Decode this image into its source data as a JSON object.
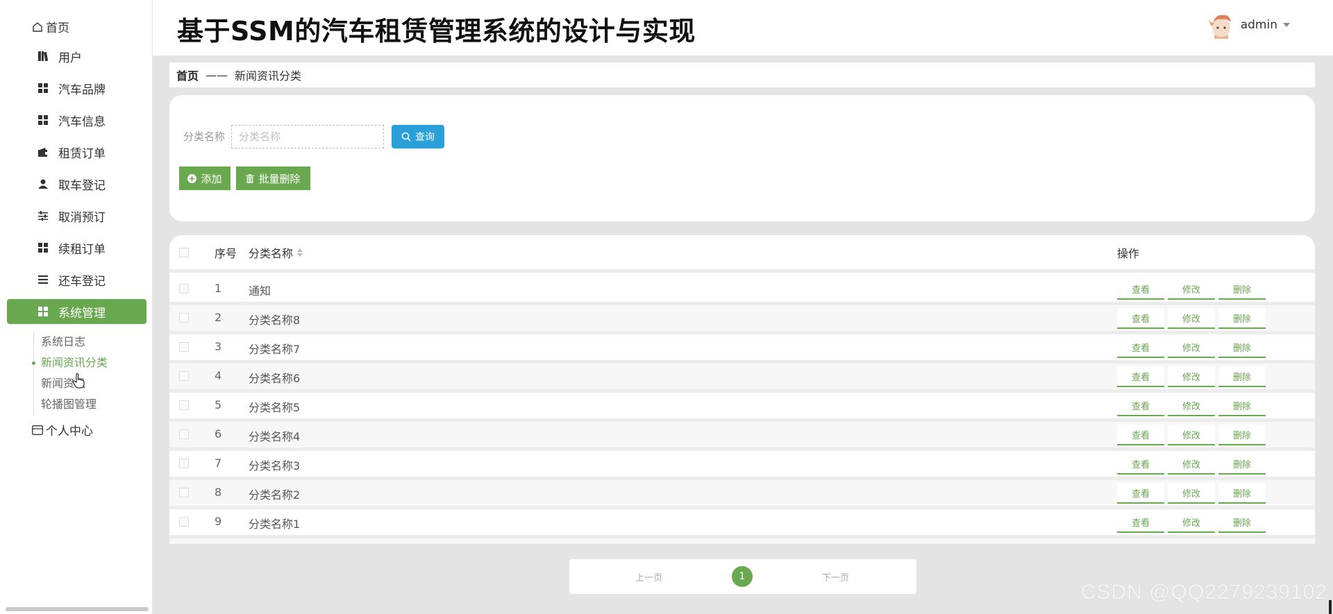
{
  "header": {
    "title": "基于SSM的汽车租赁管理系统的设计与实现",
    "username": "admin"
  },
  "sidebar": {
    "home": "首页",
    "items": [
      {
        "label": "用户",
        "icon": "book-icon"
      },
      {
        "label": "汽车品牌",
        "icon": "grid-icon"
      },
      {
        "label": "汽车信息",
        "icon": "grid-icon"
      },
      {
        "label": "租赁订单",
        "icon": "wallet-icon"
      },
      {
        "label": "取车登记",
        "icon": "user-icon"
      },
      {
        "label": "取消预订",
        "icon": "sliders-icon"
      },
      {
        "label": "续租订单",
        "icon": "grid-icon"
      },
      {
        "label": "还车登记",
        "icon": "list-icon"
      },
      {
        "label": "系统管理",
        "icon": "grid-icon",
        "active": true
      }
    ],
    "submenu": [
      {
        "label": "系统日志"
      },
      {
        "label": "新闻资讯分类",
        "active": true
      },
      {
        "label": "新闻资讯"
      },
      {
        "label": "轮播图管理"
      }
    ],
    "personal": "个人中心"
  },
  "breadcrumb": {
    "home": "首页",
    "separator": "——",
    "current": "新闻资讯分类"
  },
  "search": {
    "label": "分类名称",
    "placeholder": "分类名称",
    "value": "",
    "query_button": "查询",
    "add_button": "添加",
    "batch_delete_button": "批量删除"
  },
  "table": {
    "headers": {
      "no": "序号",
      "name": "分类名称",
      "actions": "操作"
    },
    "rows": [
      {
        "no": "1",
        "name": "通知"
      },
      {
        "no": "2",
        "name": "分类名称8"
      },
      {
        "no": "3",
        "name": "分类名称7"
      },
      {
        "no": "4",
        "name": "分类名称6"
      },
      {
        "no": "5",
        "name": "分类名称5"
      },
      {
        "no": "6",
        "name": "分类名称4"
      },
      {
        "no": "7",
        "name": "分类名称3"
      },
      {
        "no": "8",
        "name": "分类名称2"
      },
      {
        "no": "9",
        "name": "分类名称1"
      }
    ],
    "actions": {
      "view": "查看",
      "edit": "修改",
      "delete": "删除"
    }
  },
  "pagination": {
    "prev": "上一页",
    "current": "1",
    "next": "下一页"
  },
  "watermark": "CSDN @QQ2279239102",
  "colors": {
    "accent": "#6aa84f",
    "query_button": "#2aa0d8",
    "background": "#e4e4e4"
  }
}
